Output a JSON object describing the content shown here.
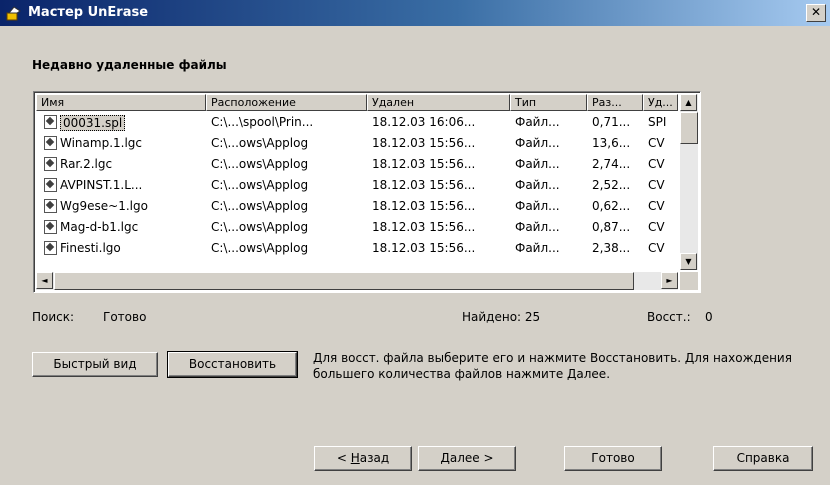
{
  "window": {
    "title": "Мастер UnErase",
    "close_glyph": "✕"
  },
  "heading": "Недавно удаленные файлы",
  "columns": [
    "Имя",
    "Расположение",
    "Удален",
    "Тип",
    "Раз...",
    "Уд..."
  ],
  "rows": [
    {
      "name": "00031.spl",
      "location": "C:\\...\\spool\\Prin...",
      "deleted": "18.12.03 16:06...",
      "type": "Файл...",
      "size": "0,71...",
      "by": "SPI"
    },
    {
      "name": "Winamp.1.lgc",
      "location": "C:\\...ows\\Applog",
      "deleted": "18.12.03 15:56...",
      "type": "Файл...",
      "size": "13,6...",
      "by": "CV"
    },
    {
      "name": "Rar.2.lgc",
      "location": "C:\\...ows\\Applog",
      "deleted": "18.12.03 15:56...",
      "type": "Файл...",
      "size": "2,74...",
      "by": "CV"
    },
    {
      "name": "AVPINST.1.L...",
      "location": "C:\\...ows\\Applog",
      "deleted": "18.12.03 15:56...",
      "type": "Файл...",
      "size": "2,52...",
      "by": "CV"
    },
    {
      "name": "Wg9ese~1.lgo",
      "location": "C:\\...ows\\Applog",
      "deleted": "18.12.03 15:56...",
      "type": "Файл...",
      "size": "0,62...",
      "by": "CV"
    },
    {
      "name": "Mag-d-b1.lgc",
      "location": "C:\\...ows\\Applog",
      "deleted": "18.12.03 15:56...",
      "type": "Файл...",
      "size": "0,87...",
      "by": "CV"
    },
    {
      "name": "Finesti.lgo",
      "location": "C:\\...ows\\Applog",
      "deleted": "18.12.03 15:56...",
      "type": "Файл...",
      "size": "2,38...",
      "by": "CV"
    }
  ],
  "status": {
    "search_label": "Поиск:",
    "search_value": "Готово",
    "found": "Найдено: 25",
    "restored_label": "Восст.:",
    "restored_value": "0"
  },
  "actions": {
    "quick_view": "Быстрый вид",
    "restore": "Восстановить"
  },
  "help_text": "Для восст. файла выберите его и нажмите Восстановить. Для нахождения большего количества файлов нажмите Далее.",
  "nav": {
    "back_prefix": "< ",
    "back_key": "Н",
    "back_rest": "азад",
    "next": "Далее >",
    "finish": "Готово",
    "help": "Справка"
  },
  "scroll": {
    "up": "▲",
    "down": "▼",
    "left": "◄",
    "right": "►"
  },
  "icons": {
    "app": "unerase-app-icon",
    "file": "deleted-file-icon"
  }
}
